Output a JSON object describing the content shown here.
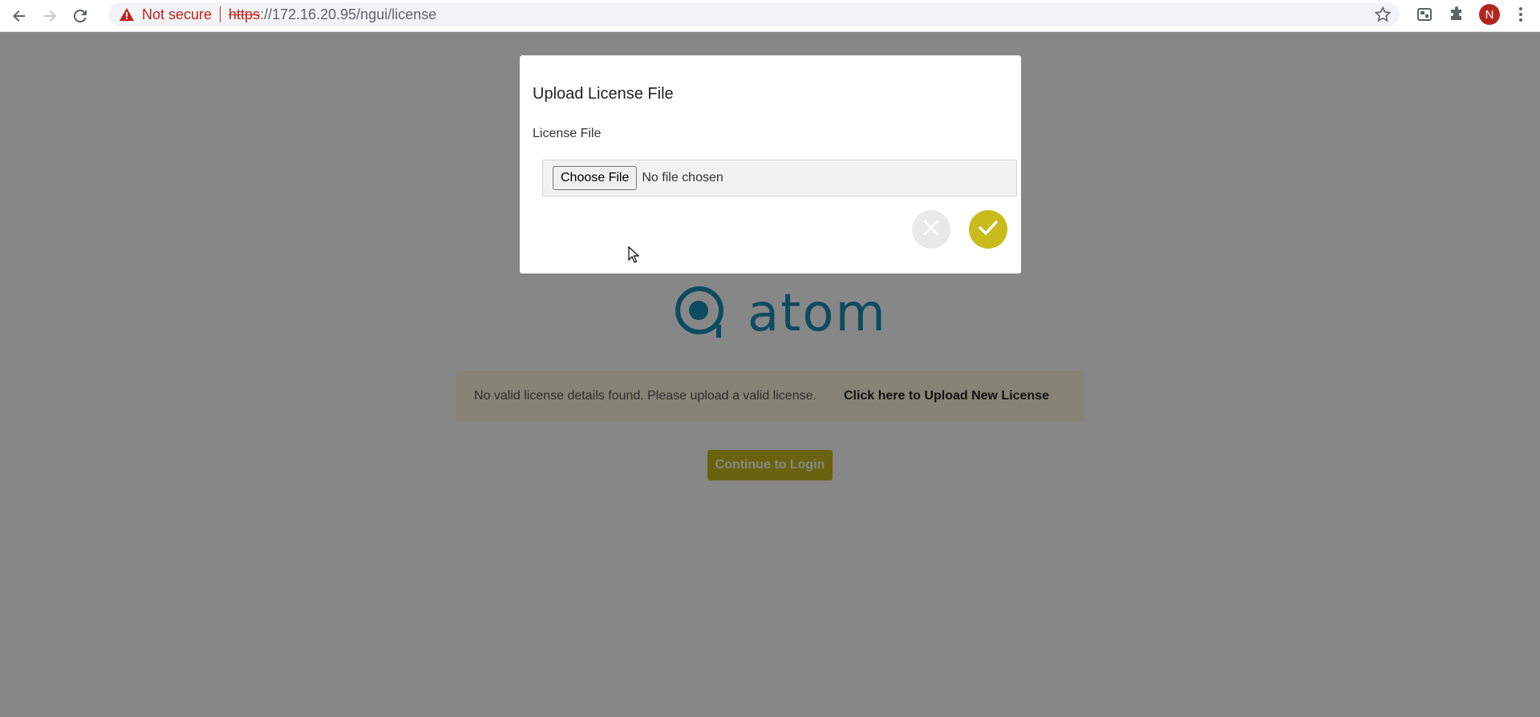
{
  "browser": {
    "security_label": "Not secure",
    "url_scheme": "https",
    "url_rest": "://172.16.20.95/ngui/license",
    "avatar_letter": "N"
  },
  "page": {
    "logo_text": "atom",
    "alert_text": "No valid license details found. Please upload a valid license.",
    "alert_link": "Click here to Upload New License",
    "continue_label": "Continue to Login"
  },
  "modal": {
    "title": "Upload License File",
    "field_label": "License File",
    "choose_file_label": "Choose File",
    "no_file_text": "No file chosen"
  },
  "colors": {
    "accent": "#c9bb1c",
    "logo": "#1a8fb8",
    "alert_bg": "#fff8dd",
    "warning": "#c5221f"
  },
  "icons": [
    "back-icon",
    "forward-icon",
    "reload-icon",
    "warning-icon",
    "star-icon",
    "extension-icon",
    "puzzle-icon",
    "menu-icon",
    "close-icon",
    "check-icon",
    "atom-logo-icon"
  ]
}
